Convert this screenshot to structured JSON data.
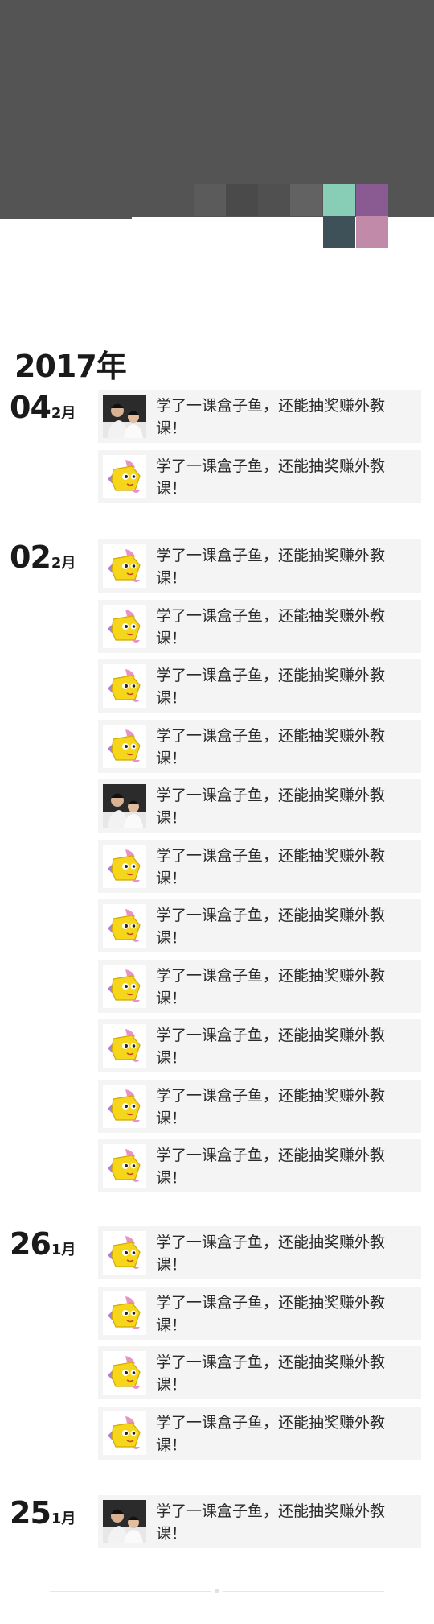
{
  "year": "2017年",
  "entry_text": "学了一课盒子鱼，还能抽奖赚外教课！",
  "colors": {
    "cover": "#545454",
    "card_bg": "#f4f4f4",
    "mosaic": [
      "#5b5b5b",
      "#4a4a4a",
      "#505050",
      "#626262",
      "#88cdb6",
      "#8a5a93",
      "#3e5058",
      "#c08aa8"
    ]
  },
  "groups": [
    {
      "day": "04",
      "month": "2月",
      "entries": [
        {
          "text": "学了一课盒子鱼，还能抽奖赚外教课！",
          "thumb": "photo-avatar"
        },
        {
          "text": "学了一课盒子鱼，还能抽奖赚外教课！",
          "thumb": "fish-icon"
        }
      ]
    },
    {
      "day": "02",
      "month": "2月",
      "entries": [
        {
          "text": "学了一课盒子鱼，还能抽奖赚外教课！",
          "thumb": "fish-icon"
        },
        {
          "text": "学了一课盒子鱼，还能抽奖赚外教课！",
          "thumb": "fish-icon"
        },
        {
          "text": "学了一课盒子鱼，还能抽奖赚外教课！",
          "thumb": "fish-icon"
        },
        {
          "text": "学了一课盒子鱼，还能抽奖赚外教课！",
          "thumb": "fish-icon"
        },
        {
          "text": "学了一课盒子鱼，还能抽奖赚外教课！",
          "thumb": "photo-avatar"
        },
        {
          "text": "学了一课盒子鱼，还能抽奖赚外教课！",
          "thumb": "fish-icon"
        },
        {
          "text": "学了一课盒子鱼，还能抽奖赚外教课！",
          "thumb": "fish-icon"
        },
        {
          "text": "学了一课盒子鱼，还能抽奖赚外教课！",
          "thumb": "fish-icon"
        },
        {
          "text": "学了一课盒子鱼，还能抽奖赚外教课！",
          "thumb": "fish-icon"
        },
        {
          "text": "学了一课盒子鱼，还能抽奖赚外教课！",
          "thumb": "fish-icon"
        },
        {
          "text": "学了一课盒子鱼，还能抽奖赚外教课！",
          "thumb": "fish-icon"
        }
      ]
    },
    {
      "day": "26",
      "month": "1月",
      "entries": [
        {
          "text": "学了一课盒子鱼，还能抽奖赚外教课！",
          "thumb": "fish-icon"
        },
        {
          "text": "学了一课盒子鱼，还能抽奖赚外教课！",
          "thumb": "fish-icon"
        },
        {
          "text": "学了一课盒子鱼，还能抽奖赚外教课！",
          "thumb": "fish-icon"
        },
        {
          "text": "学了一课盒子鱼，还能抽奖赚外教课！",
          "thumb": "fish-icon"
        }
      ]
    },
    {
      "day": "25",
      "month": "1月",
      "entries": [
        {
          "text": "学了一课盒子鱼，还能抽奖赚外教课！",
          "thumb": "photo-avatar"
        }
      ]
    }
  ]
}
